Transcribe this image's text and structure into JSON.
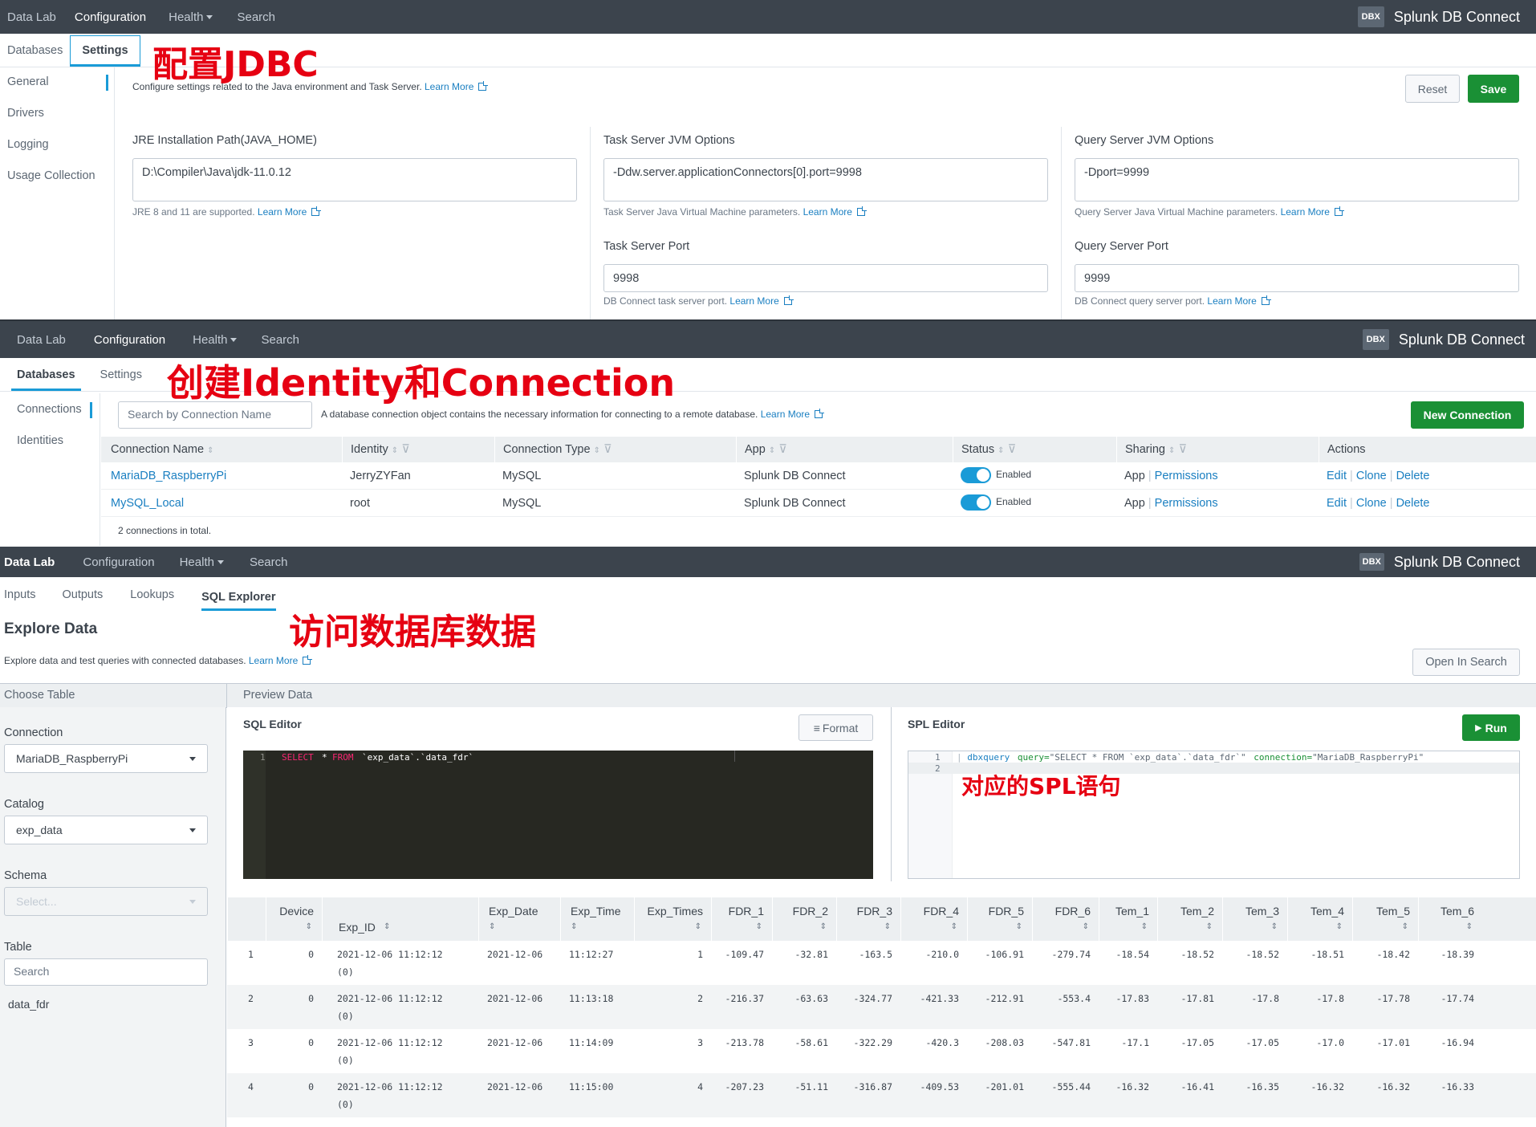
{
  "nav": {
    "data_lab": "Data Lab",
    "configuration": "Configuration",
    "health": "Health",
    "search": "Search",
    "brand_badge": "DBX",
    "brand": "Splunk DB Connect"
  },
  "p1": {
    "tabs": {
      "databases": "Databases",
      "settings": "Settings"
    },
    "annotation": "配置JDBC",
    "side": [
      "General",
      "Drivers",
      "Logging",
      "Usage Collection"
    ],
    "desc": "Configure settings related to the Java environment and Task Server.",
    "learn_more": "Learn More",
    "reset": "Reset",
    "save": "Save",
    "jre": {
      "label": "JRE Installation Path(JAVA_HOME)",
      "value": "D:\\Compiler\\Java\\jdk-11.0.12",
      "help": "JRE 8 and 11 are supported."
    },
    "task_jvm": {
      "label": "Task Server JVM Options",
      "value": "-Ddw.server.applicationConnectors[0].port=9998",
      "help": "Task Server Java Virtual Machine parameters."
    },
    "query_jvm": {
      "label": "Query Server JVM Options",
      "value": "-Dport=9999",
      "help": "Query Server Java Virtual Machine parameters."
    },
    "task_port": {
      "label": "Task Server Port",
      "value": "9998",
      "help": "DB Connect task server port."
    },
    "query_port": {
      "label": "Query Server Port",
      "value": "9999",
      "help": "DB Connect query server port."
    }
  },
  "p2": {
    "tabs": {
      "databases": "Databases",
      "settings": "Settings"
    },
    "annotation": "创建Identity和Connection",
    "side": [
      "Connections",
      "Identities"
    ],
    "search_placeholder": "Search by Connection Name",
    "desc": "A database connection object contains the necessary information for connecting to a remote database.",
    "learn_more": "Learn More",
    "new_connection": "New Connection",
    "headers": [
      "Connection Name",
      "Identity",
      "Connection Type",
      "App",
      "Status",
      "Sharing",
      "Actions"
    ],
    "rows": [
      {
        "name": "MariaDB_RaspberryPi",
        "identity": "JerryZYFan",
        "type": "MySQL",
        "app": "Splunk DB Connect",
        "status": "Enabled",
        "sharing": "App",
        "perm": "Permissions",
        "edit": "Edit",
        "clone": "Clone",
        "delete": "Delete"
      },
      {
        "name": "MySQL_Local",
        "identity": "root",
        "type": "MySQL",
        "app": "Splunk DB Connect",
        "status": "Enabled",
        "sharing": "App",
        "perm": "Permissions",
        "edit": "Edit",
        "clone": "Clone",
        "delete": "Delete"
      }
    ],
    "total": "2 connections in total."
  },
  "p3": {
    "tabs": {
      "inputs": "Inputs",
      "outputs": "Outputs",
      "lookups": "Lookups",
      "sql_explorer": "SQL Explorer"
    },
    "title": "Explore Data",
    "annotation": "访问数据库数据",
    "desc": "Explore data and test queries with connected databases.",
    "learn_more": "Learn More",
    "open_in_search": "Open In Search",
    "choose_table": "Choose Table",
    "preview_data": "Preview Data",
    "connection_label": "Connection",
    "connection_value": "MariaDB_RaspberryPi",
    "catalog_label": "Catalog",
    "catalog_value": "exp_data",
    "schema_label": "Schema",
    "schema_placeholder": "Select...",
    "table_label": "Table",
    "table_search": "Search",
    "table_item": "data_fdr",
    "sql_editor": "SQL Editor",
    "format": "Format",
    "sql": {
      "line": "1",
      "kw1": "SELECT",
      "star": "*",
      "kw2": "FROM",
      "rest": "`exp_data`.`data_fdr`"
    },
    "spl_editor": "SPL Editor",
    "run": "Run",
    "spl": {
      "l1": "1",
      "l2": "2",
      "pipe": "|",
      "cmd": "dbxquery",
      "q": "query=",
      "qv": "\"SELECT * FROM `exp_data`.`data_fdr`\"",
      "c": "connection=",
      "cv": "\"MariaDB_RaspberryPi\""
    },
    "spl_annotation": "对应的SPL语句",
    "columns": [
      "",
      "Device",
      "Exp_ID",
      "Exp_Date",
      "Exp_Time",
      "Exp_Times",
      "FDR_1",
      "FDR_2",
      "FDR_3",
      "FDR_4",
      "FDR_5",
      "FDR_6",
      "Tem_1",
      "Tem_2",
      "Tem_3",
      "Tem_4",
      "Tem_5",
      "Tem_6"
    ],
    "rows": [
      [
        "1",
        "0",
        "2021-12-06 11:12:12",
        "(0)",
        "2021-12-06",
        "11:12:27",
        "1",
        "-109.47",
        "-32.81",
        "-163.5",
        "-210.0",
        "-106.91",
        "-279.74",
        "-18.54",
        "-18.52",
        "-18.52",
        "-18.51",
        "-18.42",
        "-18.39"
      ],
      [
        "2",
        "0",
        "2021-12-06 11:12:12",
        "(0)",
        "2021-12-06",
        "11:13:18",
        "2",
        "-216.37",
        "-63.63",
        "-324.77",
        "-421.33",
        "-212.91",
        "-553.4",
        "-17.83",
        "-17.81",
        "-17.8",
        "-17.8",
        "-17.78",
        "-17.74"
      ],
      [
        "3",
        "0",
        "2021-12-06 11:12:12",
        "(0)",
        "2021-12-06",
        "11:14:09",
        "3",
        "-213.78",
        "-58.61",
        "-322.29",
        "-420.3",
        "-208.03",
        "-547.81",
        "-17.1",
        "-17.05",
        "-17.05",
        "-17.0",
        "-17.01",
        "-16.94"
      ],
      [
        "4",
        "0",
        "2021-12-06 11:12:12",
        "(0)",
        "2021-12-06",
        "11:15:00",
        "4",
        "-207.23",
        "-51.11",
        "-316.87",
        "-409.53",
        "-201.01",
        "-555.44",
        "-16.32",
        "-16.41",
        "-16.35",
        "-16.32",
        "-16.32",
        "-16.33"
      ]
    ]
  }
}
